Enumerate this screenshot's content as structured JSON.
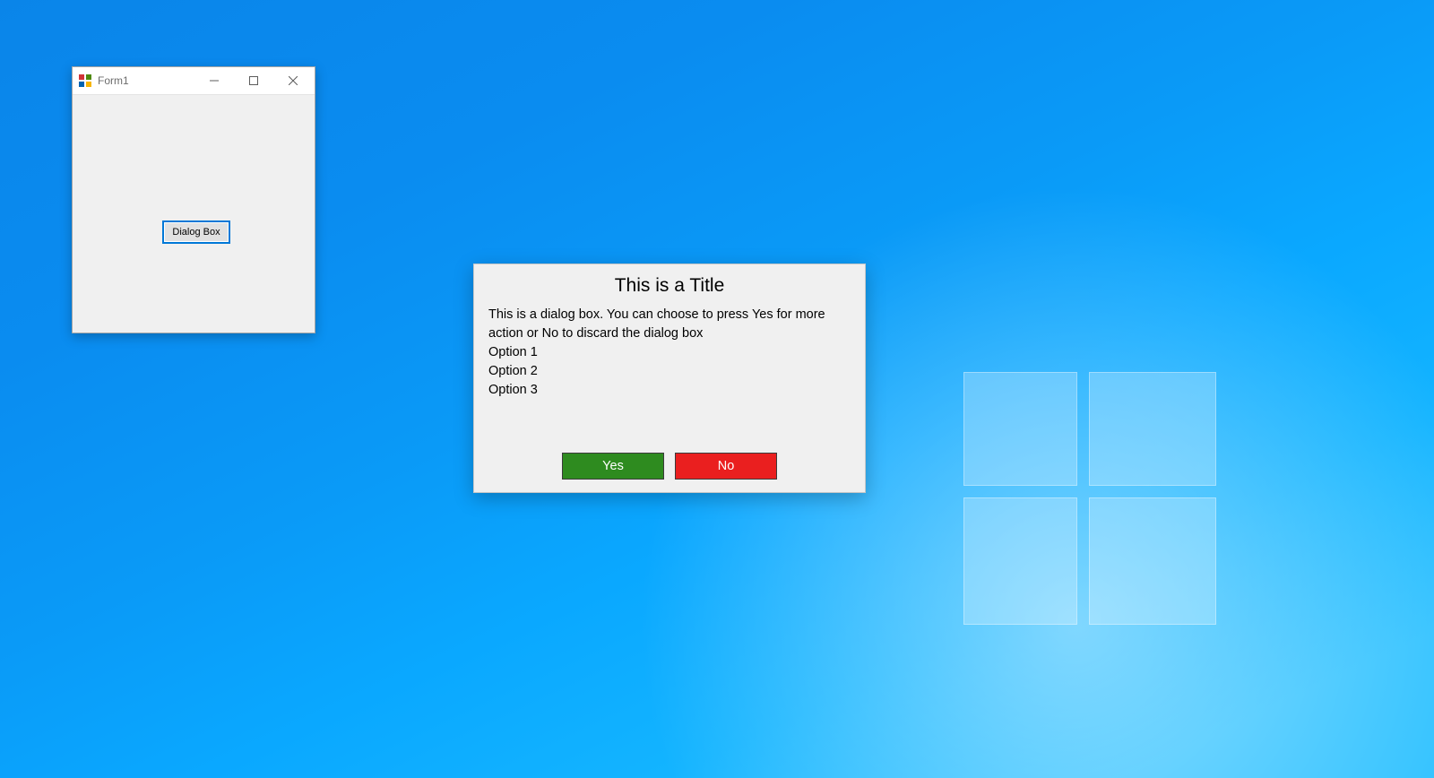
{
  "form1": {
    "title": "Form1",
    "button_label": "Dialog Box"
  },
  "dialog": {
    "title": "This is a Title",
    "message": "This is a dialog box. You can choose to press Yes for more action or No to discard the dialog box",
    "options": [
      "Option 1",
      "Option 2",
      "Option 3"
    ],
    "yes_label": "Yes",
    "no_label": "No"
  },
  "colors": {
    "yes_bg": "#2e8b1f",
    "no_bg": "#ea1f1f",
    "focus_border": "#0078d7"
  }
}
